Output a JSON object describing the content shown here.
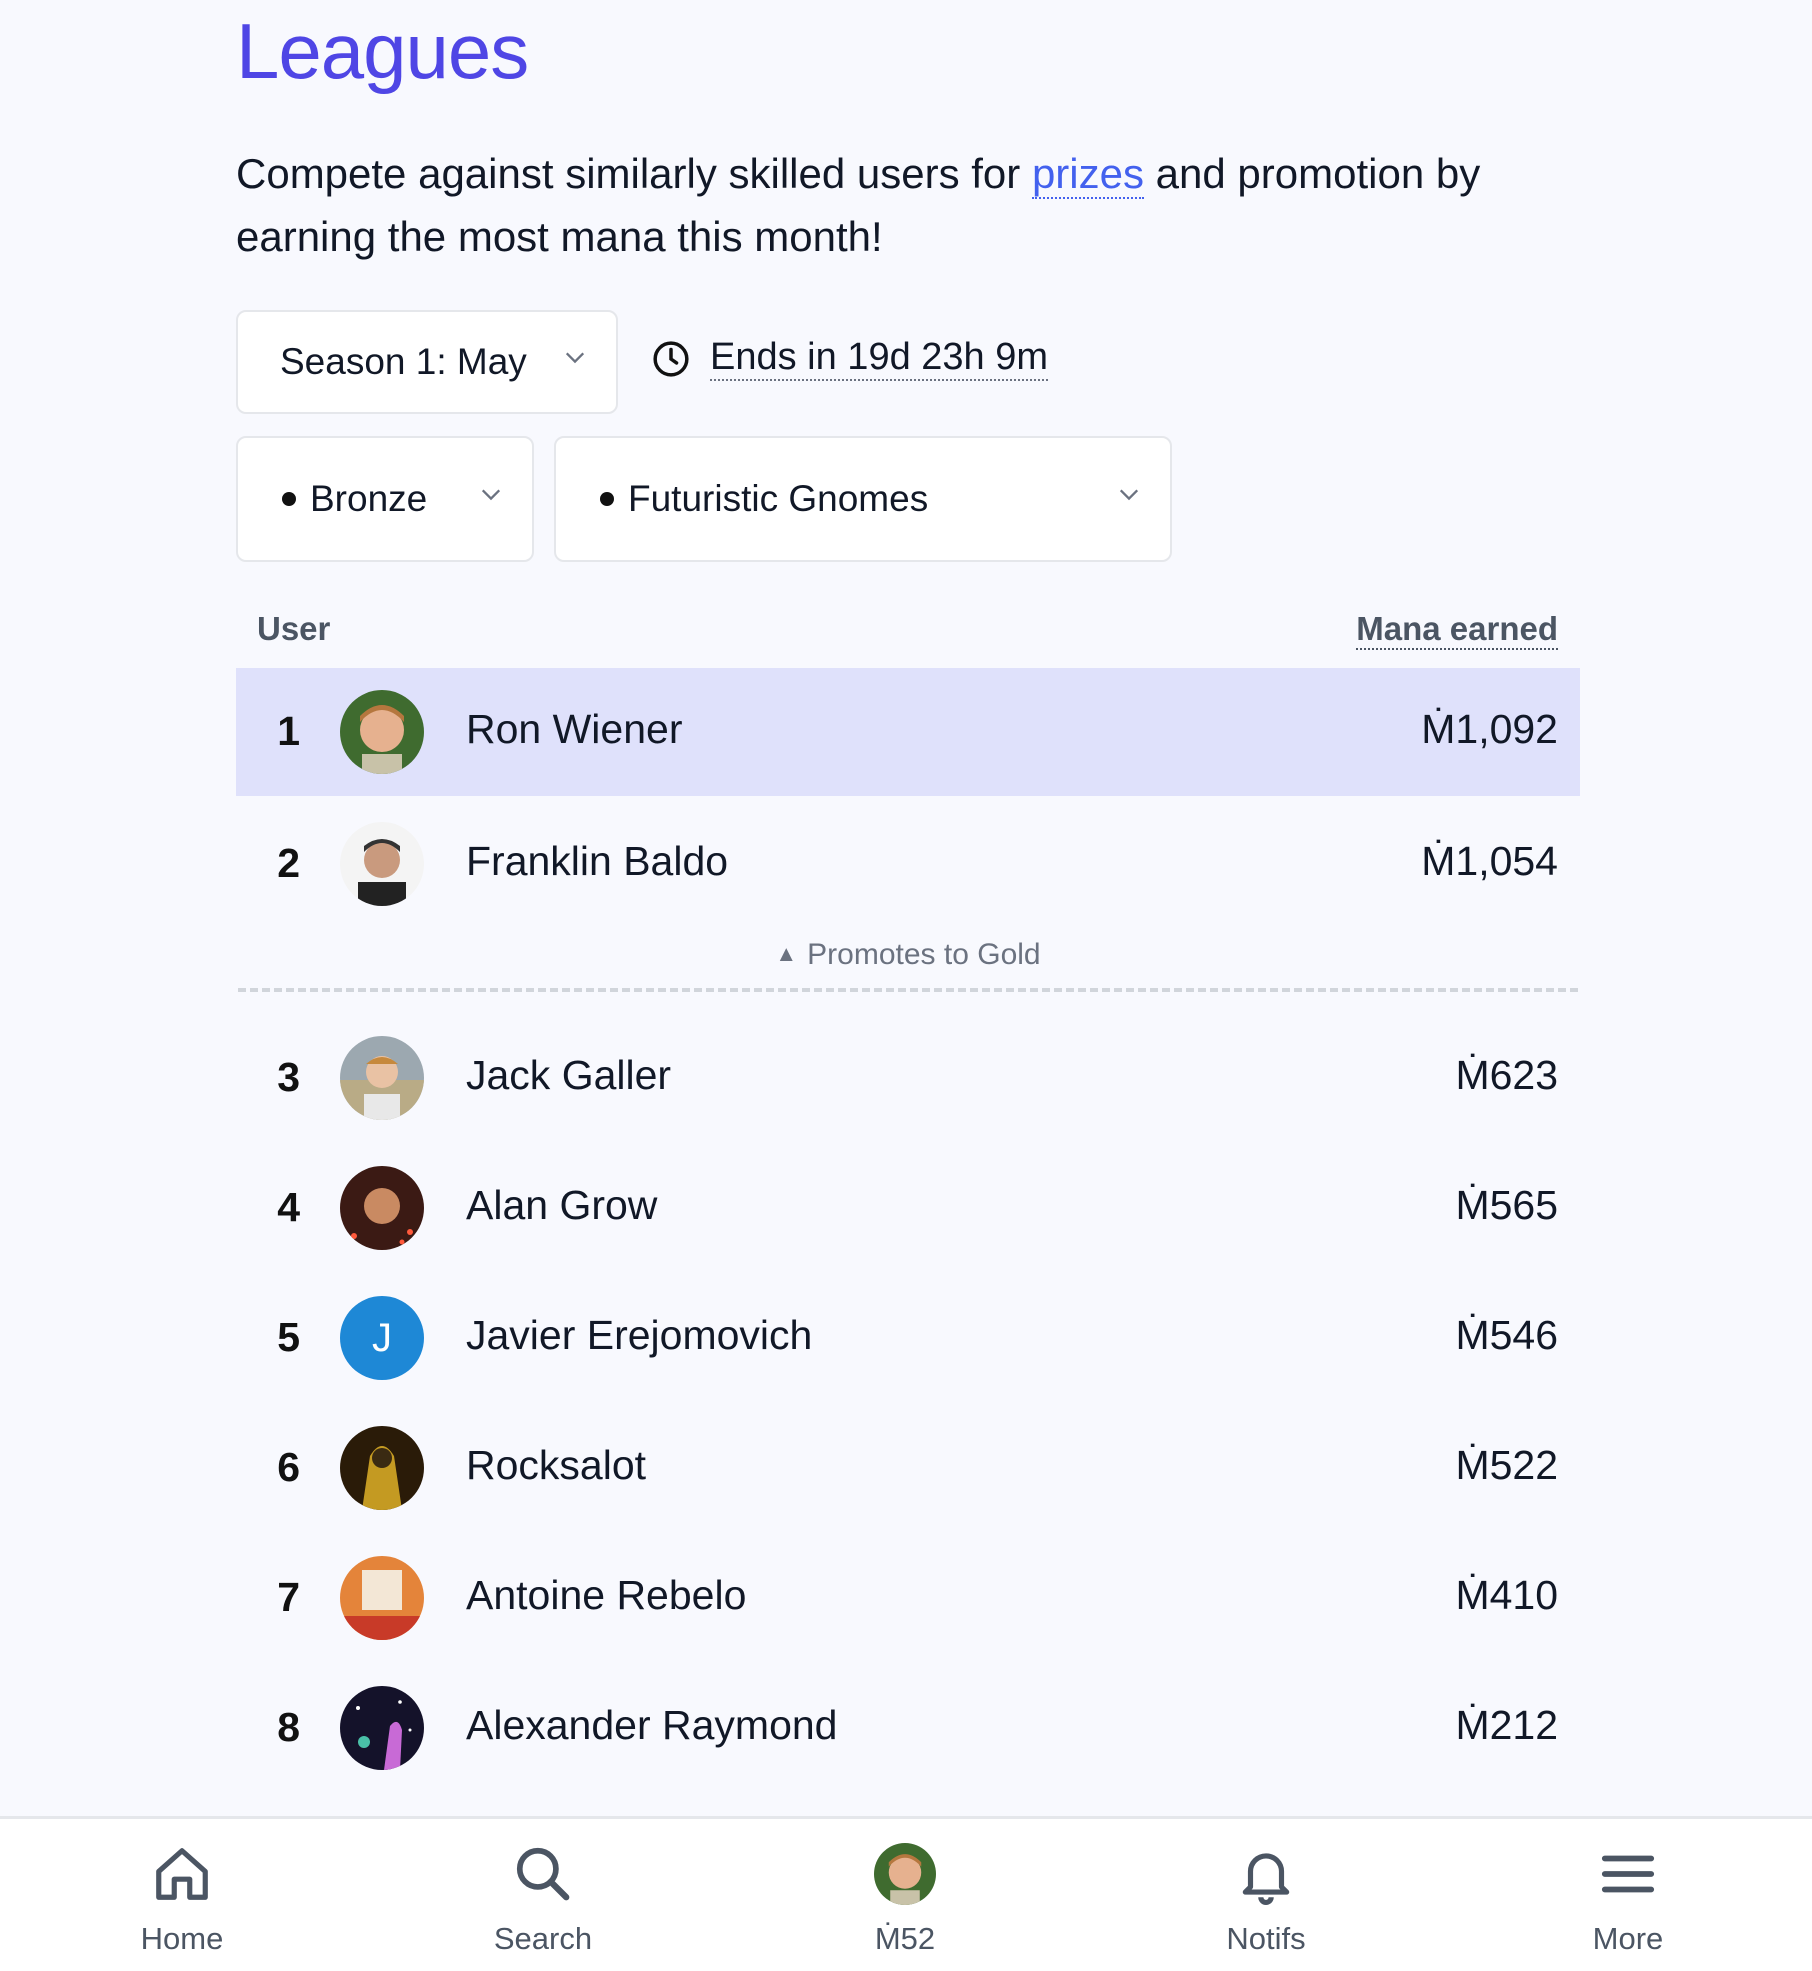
{
  "header": {
    "title": "Leagues"
  },
  "description": {
    "before": "Compete against similarly skilled users for ",
    "link": "prizes",
    "after": " and promotion by earning the most mana this month!"
  },
  "season": {
    "label": "Season 1: May",
    "ends_text": "Ends in 19d 23h 9m"
  },
  "tier": {
    "label": "Bronze"
  },
  "division": {
    "label": "Futuristic Gnomes"
  },
  "table": {
    "col_user": "User",
    "col_mana": "Mana earned",
    "promote_label": "Promotes to Gold",
    "rows": [
      {
        "rank": "1",
        "name": "Ron Wiener",
        "mana": "Ṁ1,092",
        "highlight": true
      },
      {
        "rank": "2",
        "name": "Franklin Baldo",
        "mana": "Ṁ1,054"
      },
      {
        "rank": "3",
        "name": "Jack Galler",
        "mana": "Ṁ623"
      },
      {
        "rank": "4",
        "name": "Alan Grow",
        "mana": "Ṁ565"
      },
      {
        "rank": "5",
        "name": "Javier Erejomovich",
        "mana": "Ṁ546",
        "avatar_letter": "J"
      },
      {
        "rank": "6",
        "name": "Rocksalot",
        "mana": "Ṁ522"
      },
      {
        "rank": "7",
        "name": "Antoine Rebelo",
        "mana": "Ṁ410"
      },
      {
        "rank": "8",
        "name": "Alexander Raymond",
        "mana": "Ṁ212"
      }
    ]
  },
  "nav": {
    "home": "Home",
    "search": "Search",
    "balance": "Ṁ52",
    "notifs": "Notifs",
    "more": "More"
  },
  "colors": {
    "accent": "#4f46e5",
    "link": "#4361ee",
    "highlight_row": "#dfe1fb"
  },
  "icons": [
    "chevron-down-icon",
    "clock-icon",
    "home-icon",
    "search-icon",
    "bell-icon",
    "menu-icon"
  ]
}
